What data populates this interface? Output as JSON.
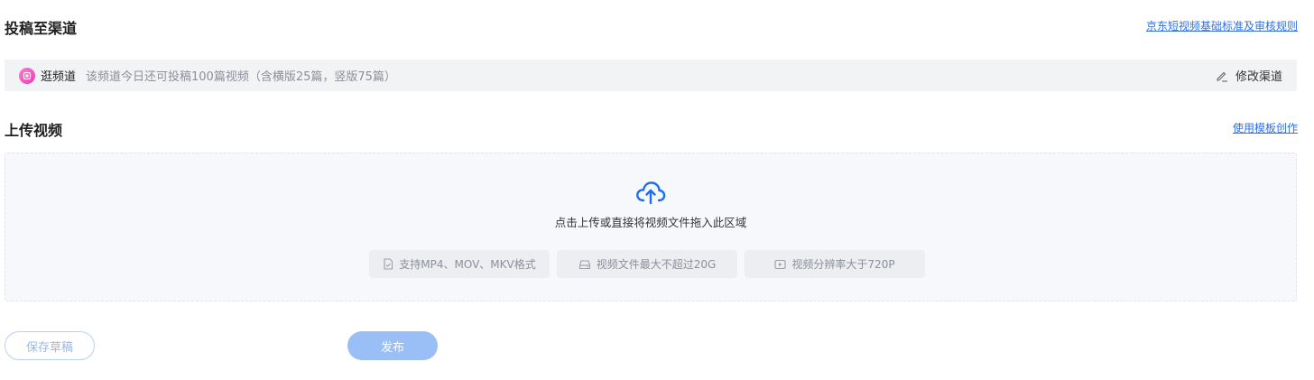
{
  "submit_section": {
    "title": "投稿至渠道",
    "rules_link": "京东短视频基础标准及审核规则"
  },
  "channel": {
    "icon": "channel-logo-icon",
    "name": "逛频道",
    "description": "该频道今日还可投稿100篇视频（含横版25篇，竖版75篇）",
    "edit_label": "修改渠道"
  },
  "upload_section": {
    "title": "上传视频",
    "template_link": "使用模板创作",
    "hint": "点击上传或直接将视频文件拖入此区域",
    "tags": [
      {
        "icon": "file-icon",
        "label": "支持MP4、MOV、MKV格式"
      },
      {
        "icon": "disk-icon",
        "label": "视频文件最大不超过20G"
      },
      {
        "icon": "video-icon",
        "label": "视频分辨率大于720P"
      }
    ]
  },
  "actions": {
    "save_draft": "保存草稿",
    "publish": "发布"
  },
  "colors": {
    "accent": "#2f6fe6",
    "publish_disabled": "#99bff6"
  }
}
